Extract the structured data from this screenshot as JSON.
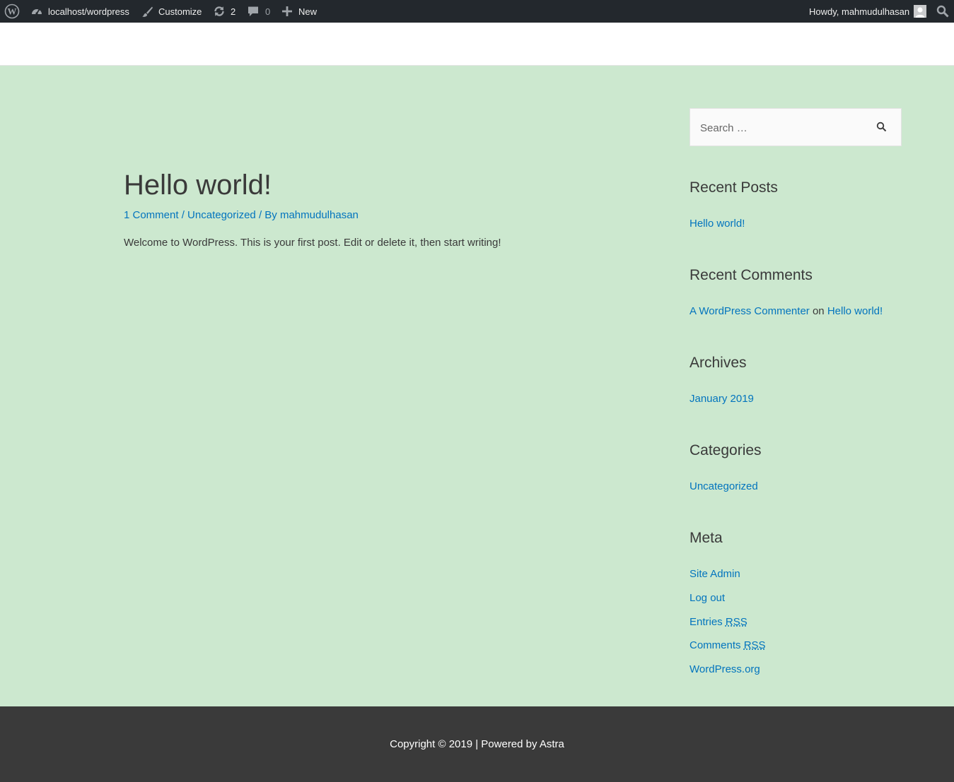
{
  "adminbar": {
    "site_name": "localhost/wordpress",
    "customize": "Customize",
    "updates_count": "2",
    "comments_count": "0",
    "new_label": "New",
    "howdy": "Howdy, mahmudulhasan",
    "icons": [
      "wordpress-logo-icon",
      "dashboard-icon",
      "brush-icon",
      "updates-icon",
      "comment-icon",
      "plus-icon",
      "avatar-icon",
      "search-icon"
    ]
  },
  "post": {
    "title": "Hello world!",
    "comments_link": "1 Comment",
    "sep1": " / ",
    "category": "Uncategorized",
    "sep2": " / By ",
    "author": "mahmudulhasan",
    "content": "Welcome to WordPress. This is your first post. Edit or delete it, then start writing!"
  },
  "sidebar": {
    "search_placeholder": "Search …",
    "recent_posts": {
      "title": "Recent Posts",
      "items": [
        "Hello world!"
      ]
    },
    "recent_comments": {
      "title": "Recent Comments",
      "author": "A WordPress Commenter",
      "on": " on ",
      "post": "Hello world!"
    },
    "archives": {
      "title": "Archives",
      "items": [
        "January 2019"
      ]
    },
    "categories": {
      "title": "Categories",
      "items": [
        "Uncategorized"
      ]
    },
    "meta": {
      "title": "Meta",
      "site_admin": "Site Admin",
      "log_out": "Log out",
      "entries": "Entries ",
      "comments": "Comments ",
      "rss": "RSS",
      "wordpress_org": "WordPress.org"
    }
  },
  "footer": {
    "copyright": "Copyright © 2019 | Powered by ",
    "astra": "Astra"
  },
  "colors": {
    "background": "#cce8cf",
    "link": "#0274be",
    "adminbar": "#23282d",
    "footer": "#3a3a3a"
  }
}
